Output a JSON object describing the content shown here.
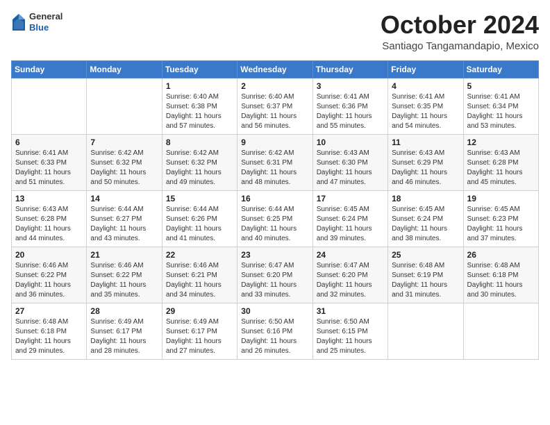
{
  "header": {
    "logo": {
      "general": "General",
      "blue": "Blue"
    },
    "title": "October 2024",
    "location": "Santiago Tangamandapio, Mexico"
  },
  "weekdays": [
    "Sunday",
    "Monday",
    "Tuesday",
    "Wednesday",
    "Thursday",
    "Friday",
    "Saturday"
  ],
  "weeks": [
    [
      {
        "day": "",
        "info": ""
      },
      {
        "day": "",
        "info": ""
      },
      {
        "day": "1",
        "info": "Sunrise: 6:40 AM\nSunset: 6:38 PM\nDaylight: 11 hours and 57 minutes."
      },
      {
        "day": "2",
        "info": "Sunrise: 6:40 AM\nSunset: 6:37 PM\nDaylight: 11 hours and 56 minutes."
      },
      {
        "day": "3",
        "info": "Sunrise: 6:41 AM\nSunset: 6:36 PM\nDaylight: 11 hours and 55 minutes."
      },
      {
        "day": "4",
        "info": "Sunrise: 6:41 AM\nSunset: 6:35 PM\nDaylight: 11 hours and 54 minutes."
      },
      {
        "day": "5",
        "info": "Sunrise: 6:41 AM\nSunset: 6:34 PM\nDaylight: 11 hours and 53 minutes."
      }
    ],
    [
      {
        "day": "6",
        "info": "Sunrise: 6:41 AM\nSunset: 6:33 PM\nDaylight: 11 hours and 51 minutes."
      },
      {
        "day": "7",
        "info": "Sunrise: 6:42 AM\nSunset: 6:32 PM\nDaylight: 11 hours and 50 minutes."
      },
      {
        "day": "8",
        "info": "Sunrise: 6:42 AM\nSunset: 6:32 PM\nDaylight: 11 hours and 49 minutes."
      },
      {
        "day": "9",
        "info": "Sunrise: 6:42 AM\nSunset: 6:31 PM\nDaylight: 11 hours and 48 minutes."
      },
      {
        "day": "10",
        "info": "Sunrise: 6:43 AM\nSunset: 6:30 PM\nDaylight: 11 hours and 47 minutes."
      },
      {
        "day": "11",
        "info": "Sunrise: 6:43 AM\nSunset: 6:29 PM\nDaylight: 11 hours and 46 minutes."
      },
      {
        "day": "12",
        "info": "Sunrise: 6:43 AM\nSunset: 6:28 PM\nDaylight: 11 hours and 45 minutes."
      }
    ],
    [
      {
        "day": "13",
        "info": "Sunrise: 6:43 AM\nSunset: 6:28 PM\nDaylight: 11 hours and 44 minutes."
      },
      {
        "day": "14",
        "info": "Sunrise: 6:44 AM\nSunset: 6:27 PM\nDaylight: 11 hours and 43 minutes."
      },
      {
        "day": "15",
        "info": "Sunrise: 6:44 AM\nSunset: 6:26 PM\nDaylight: 11 hours and 41 minutes."
      },
      {
        "day": "16",
        "info": "Sunrise: 6:44 AM\nSunset: 6:25 PM\nDaylight: 11 hours and 40 minutes."
      },
      {
        "day": "17",
        "info": "Sunrise: 6:45 AM\nSunset: 6:24 PM\nDaylight: 11 hours and 39 minutes."
      },
      {
        "day": "18",
        "info": "Sunrise: 6:45 AM\nSunset: 6:24 PM\nDaylight: 11 hours and 38 minutes."
      },
      {
        "day": "19",
        "info": "Sunrise: 6:45 AM\nSunset: 6:23 PM\nDaylight: 11 hours and 37 minutes."
      }
    ],
    [
      {
        "day": "20",
        "info": "Sunrise: 6:46 AM\nSunset: 6:22 PM\nDaylight: 11 hours and 36 minutes."
      },
      {
        "day": "21",
        "info": "Sunrise: 6:46 AM\nSunset: 6:22 PM\nDaylight: 11 hours and 35 minutes."
      },
      {
        "day": "22",
        "info": "Sunrise: 6:46 AM\nSunset: 6:21 PM\nDaylight: 11 hours and 34 minutes."
      },
      {
        "day": "23",
        "info": "Sunrise: 6:47 AM\nSunset: 6:20 PM\nDaylight: 11 hours and 33 minutes."
      },
      {
        "day": "24",
        "info": "Sunrise: 6:47 AM\nSunset: 6:20 PM\nDaylight: 11 hours and 32 minutes."
      },
      {
        "day": "25",
        "info": "Sunrise: 6:48 AM\nSunset: 6:19 PM\nDaylight: 11 hours and 31 minutes."
      },
      {
        "day": "26",
        "info": "Sunrise: 6:48 AM\nSunset: 6:18 PM\nDaylight: 11 hours and 30 minutes."
      }
    ],
    [
      {
        "day": "27",
        "info": "Sunrise: 6:48 AM\nSunset: 6:18 PM\nDaylight: 11 hours and 29 minutes."
      },
      {
        "day": "28",
        "info": "Sunrise: 6:49 AM\nSunset: 6:17 PM\nDaylight: 11 hours and 28 minutes."
      },
      {
        "day": "29",
        "info": "Sunrise: 6:49 AM\nSunset: 6:17 PM\nDaylight: 11 hours and 27 minutes."
      },
      {
        "day": "30",
        "info": "Sunrise: 6:50 AM\nSunset: 6:16 PM\nDaylight: 11 hours and 26 minutes."
      },
      {
        "day": "31",
        "info": "Sunrise: 6:50 AM\nSunset: 6:15 PM\nDaylight: 11 hours and 25 minutes."
      },
      {
        "day": "",
        "info": ""
      },
      {
        "day": "",
        "info": ""
      }
    ]
  ]
}
